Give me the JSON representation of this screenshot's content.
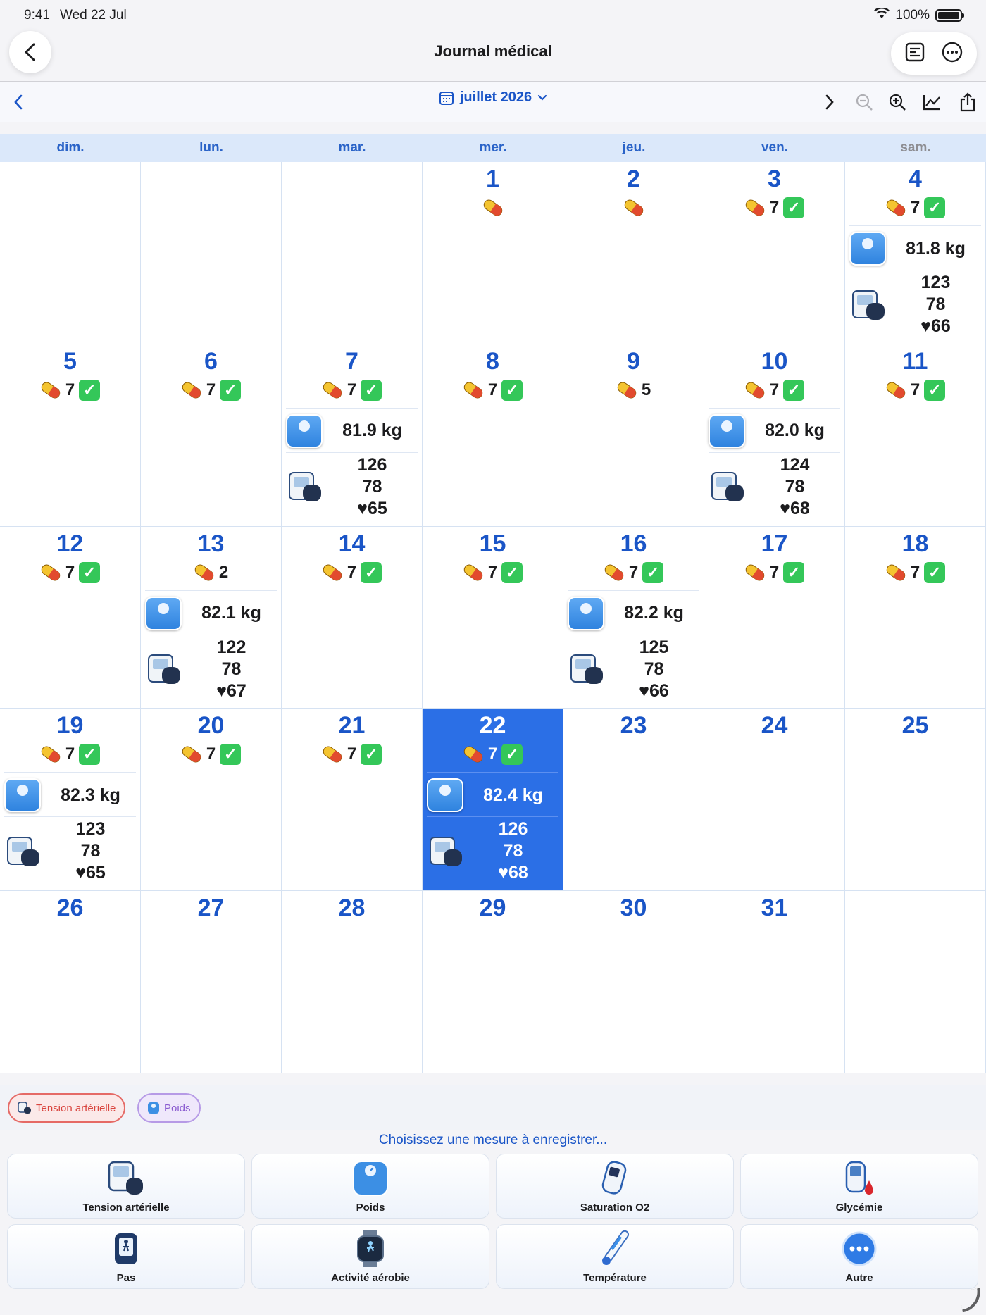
{
  "status": {
    "time": "9:41",
    "date": "Wed 22 Jul",
    "battery": "100%",
    "battery_level": 100
  },
  "nav": {
    "title": "Journal médical"
  },
  "toolbar": {
    "month": "juillet 2026"
  },
  "weekdays": [
    "dim.",
    "lun.",
    "mar.",
    "mer.",
    "jeu.",
    "ven.",
    "sam."
  ],
  "calendar": {
    "today_index": 24,
    "cells": [
      {},
      {},
      {},
      {
        "day": "1",
        "med": true
      },
      {
        "day": "2",
        "med": true
      },
      {
        "day": "3",
        "med": true,
        "count": "7",
        "check": true
      },
      {
        "day": "4",
        "med": true,
        "count": "7",
        "check": true,
        "weight": "81.8 kg",
        "sys": "123",
        "dia": "78",
        "hr": "♥66"
      },
      {
        "day": "5",
        "med": true,
        "count": "7",
        "check": true
      },
      {
        "day": "6",
        "med": true,
        "count": "7",
        "check": true
      },
      {
        "day": "7",
        "med": true,
        "count": "7",
        "check": true,
        "weight": "81.9 kg",
        "sys": "126",
        "dia": "78",
        "hr": "♥65"
      },
      {
        "day": "8",
        "med": true,
        "count": "7",
        "check": true
      },
      {
        "day": "9",
        "med": true,
        "count": "5"
      },
      {
        "day": "10",
        "med": true,
        "count": "7",
        "check": true,
        "weight": "82.0 kg",
        "sys": "124",
        "dia": "78",
        "hr": "♥68"
      },
      {
        "day": "11",
        "med": true,
        "count": "7",
        "check": true
      },
      {
        "day": "12",
        "med": true,
        "count": "7",
        "check": true
      },
      {
        "day": "13",
        "med": true,
        "count": "2",
        "weight": "82.1 kg",
        "sys": "122",
        "dia": "78",
        "hr": "♥67"
      },
      {
        "day": "14",
        "med": true,
        "count": "7",
        "check": true
      },
      {
        "day": "15",
        "med": true,
        "count": "7",
        "check": true
      },
      {
        "day": "16",
        "med": true,
        "count": "7",
        "check": true,
        "weight": "82.2 kg",
        "sys": "125",
        "dia": "78",
        "hr": "♥66"
      },
      {
        "day": "17",
        "med": true,
        "count": "7",
        "check": true
      },
      {
        "day": "18",
        "med": true,
        "count": "7",
        "check": true
      },
      {
        "day": "19",
        "med": true,
        "count": "7",
        "check": true,
        "weight": "82.3 kg",
        "sys": "123",
        "dia": "78",
        "hr": "♥65"
      },
      {
        "day": "20",
        "med": true,
        "count": "7",
        "check": true
      },
      {
        "day": "21",
        "med": true,
        "count": "7",
        "check": true
      },
      {
        "day": "22",
        "med": true,
        "count": "7",
        "check": true,
        "weight": "82.4 kg",
        "sys": "126",
        "dia": "78",
        "hr": "♥68"
      },
      {
        "day": "23"
      },
      {
        "day": "24"
      },
      {
        "day": "25"
      },
      {
        "day": "26"
      },
      {
        "day": "27"
      },
      {
        "day": "28"
      },
      {
        "day": "29"
      },
      {
        "day": "30"
      },
      {
        "day": "31"
      },
      {}
    ]
  },
  "chips": {
    "bp": "Tension artérielle",
    "weight": "Poids"
  },
  "measure": {
    "title": "Choisissez une mesure à enregistrer...",
    "buttons": [
      {
        "label": "Tension artérielle",
        "icon": "bp-monitor-icon"
      },
      {
        "label": "Poids",
        "icon": "scale-icon"
      },
      {
        "label": "Saturation O2",
        "icon": "oximeter-icon"
      },
      {
        "label": "Glycémie",
        "icon": "glucose-meter-icon"
      },
      {
        "label": "Pas",
        "icon": "steps-icon"
      },
      {
        "label": "Activité aérobie",
        "icon": "watch-icon"
      },
      {
        "label": "Température",
        "icon": "thermometer-icon"
      },
      {
        "label": "Autre",
        "icon": "more-icon"
      }
    ]
  },
  "colors": {
    "accent": "#1a55c7",
    "today": "#2b6fe6",
    "check": "#34c759",
    "bp_chip": "#d9453f",
    "weight_chip": "#8a5bd0"
  }
}
